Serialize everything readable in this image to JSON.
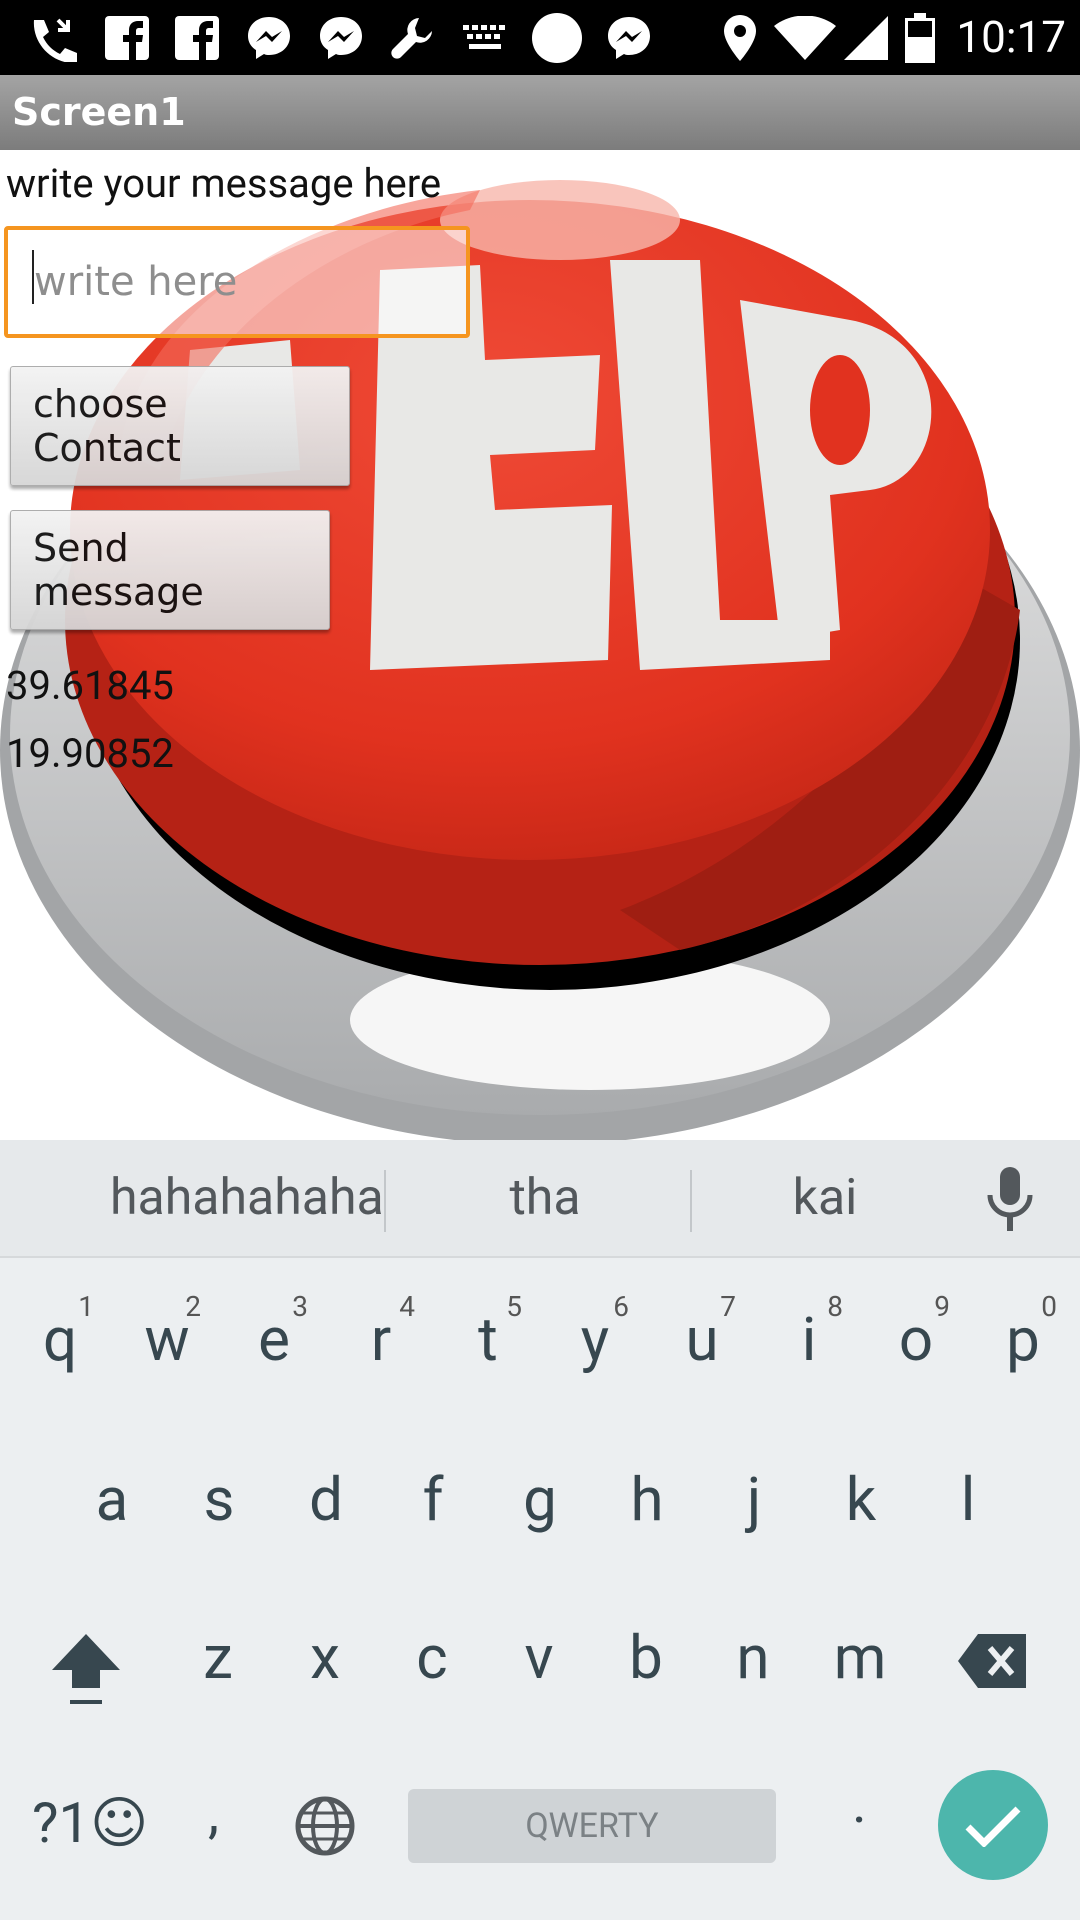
{
  "status_bar": {
    "time": "10:17",
    "icons": [
      "missed-call-icon",
      "facebook-icon",
      "facebook-icon",
      "messenger-icon",
      "messenger-icon",
      "wrench-icon",
      "keyboard-icon",
      "circle-icon",
      "messenger-icon",
      "location-icon",
      "wifi-icon",
      "signal-icon",
      "battery-icon"
    ]
  },
  "title_bar": {
    "title": "Screen1"
  },
  "form": {
    "label": "write your message here",
    "input_placeholder": "write here",
    "input_value": "",
    "choose_contact_label": "choose Contact",
    "send_message_label": "Send message",
    "latitude": "39.61845",
    "longitude": "19.90852"
  },
  "keyboard": {
    "suggestions": [
      "hahahahaha",
      "tha",
      "kai"
    ],
    "row1": [
      {
        "k": "q",
        "h": "1"
      },
      {
        "k": "w",
        "h": "2"
      },
      {
        "k": "e",
        "h": "3"
      },
      {
        "k": "r",
        "h": "4"
      },
      {
        "k": "t",
        "h": "5"
      },
      {
        "k": "y",
        "h": "6"
      },
      {
        "k": "u",
        "h": "7"
      },
      {
        "k": "i",
        "h": "8"
      },
      {
        "k": "o",
        "h": "9"
      },
      {
        "k": "p",
        "h": "0"
      }
    ],
    "row2": [
      "a",
      "s",
      "d",
      "f",
      "g",
      "h",
      "j",
      "k",
      "l"
    ],
    "row3": [
      "z",
      "x",
      "c",
      "v",
      "b",
      "n",
      "m"
    ],
    "symbols_label": "?1☺",
    "comma_label": ",",
    "period_label": ".",
    "space_label": "QWERTY",
    "accent_color": "#4db6ac"
  }
}
